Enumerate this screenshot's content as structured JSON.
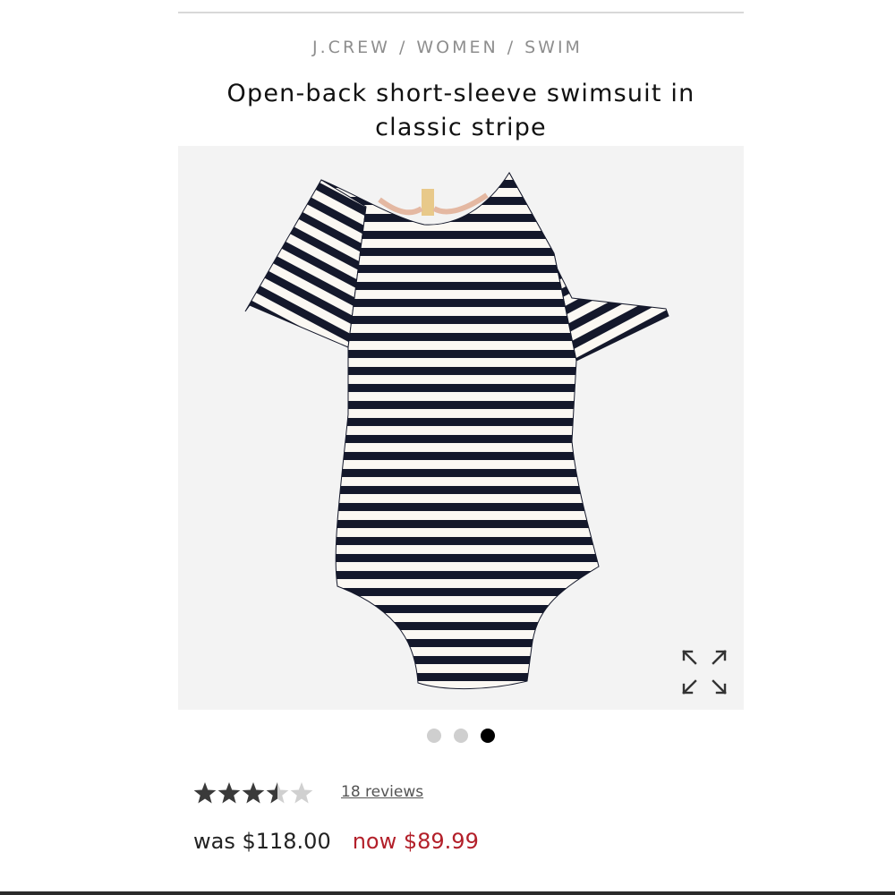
{
  "breadcrumb": {
    "items": [
      "J.CREW",
      "WOMEN",
      "SWIM"
    ],
    "separator": "/"
  },
  "product": {
    "title_line1": "Open-back short-sleeve swimsuit in",
    "title_line2": "classic stripe",
    "image_alt_icon": "expand-icon"
  },
  "carousel": {
    "total": 3,
    "active_index": 2
  },
  "rating": {
    "value": 3.5,
    "max": 5,
    "reviews_label": "18 reviews"
  },
  "price": {
    "was": "was $118.00",
    "now": "now $89.99"
  },
  "colors": {
    "stripe": "#14182b",
    "sale": "#b3202a",
    "panel_bg": "#f3f3f3"
  }
}
